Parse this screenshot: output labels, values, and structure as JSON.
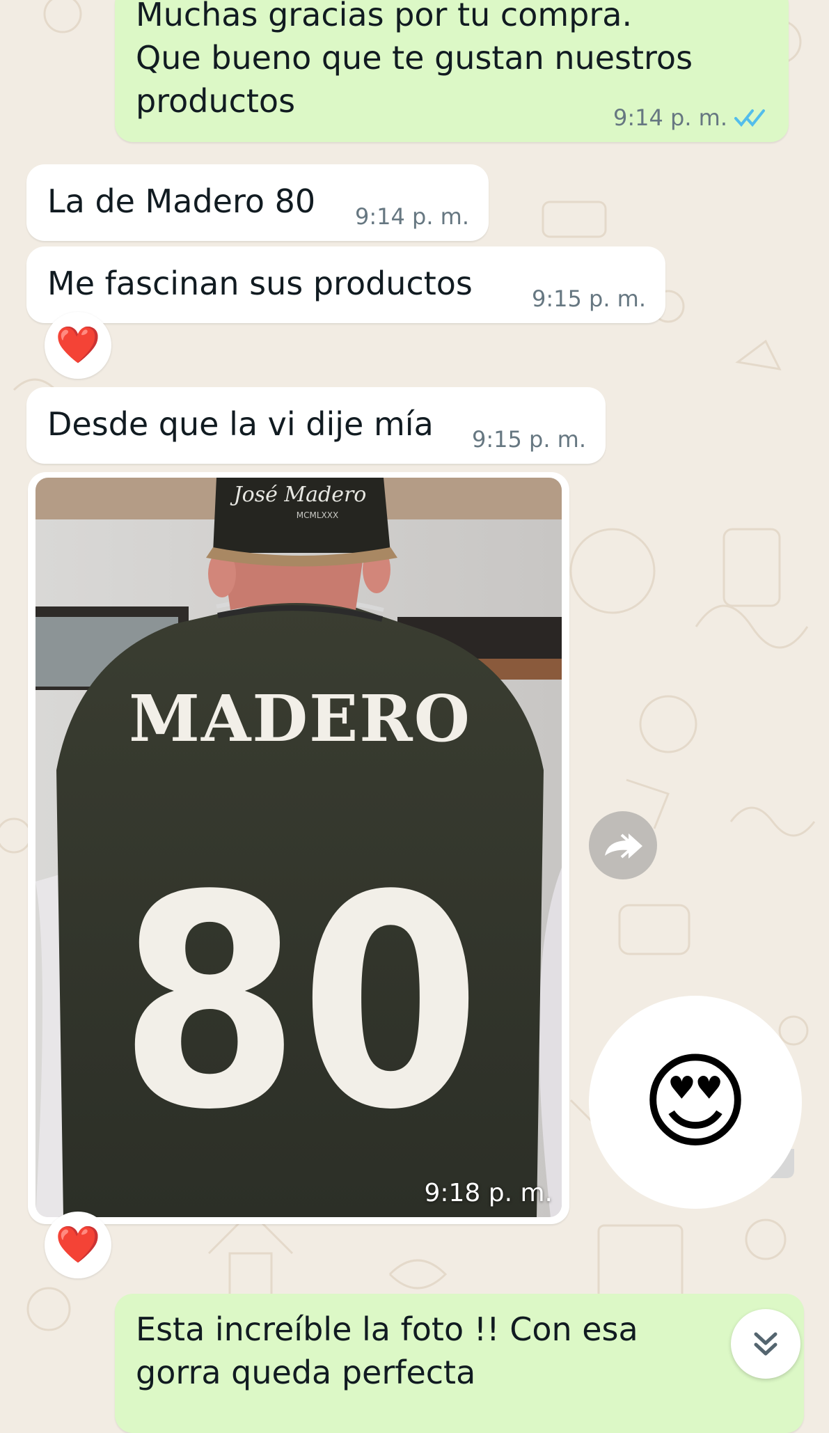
{
  "messages": [
    {
      "direction": "outgoing",
      "text": "Muchas gracias por tu compra.\nQue bueno que te gustan nuestros\nproductos",
      "time": "9:14 p. m.",
      "status": "read"
    },
    {
      "direction": "incoming",
      "text": "La de Madero 80",
      "time": "9:14 p. m."
    },
    {
      "direction": "incoming",
      "text": "Me fascinan sus productos",
      "time": "9:15 p. m.",
      "reaction": "❤️"
    },
    {
      "direction": "incoming",
      "text": "Desde que la vi dije mía",
      "time": "9:15 p. m."
    },
    {
      "direction": "incoming",
      "type": "image",
      "time": "9:18 p. m.",
      "reaction": "❤️",
      "image_content": {
        "cap_text": "José Madero",
        "cap_subtext": "MCMLXXX",
        "jacket_name": "MADERO",
        "jacket_number": "80"
      }
    },
    {
      "direction": "incoming",
      "type": "sticker",
      "sticker": "😍"
    },
    {
      "direction": "outgoing",
      "text": "Esta increíble la foto !! Con esa\ngorra queda perfecta"
    }
  ],
  "icons": {
    "read_ticks": "double-check-icon",
    "forward": "forward-icon",
    "scroll_down": "chevron-double-down-icon",
    "heart": "red-heart-emoji",
    "sticker": "heart-eyes-emoji"
  },
  "colors": {
    "outgoing_bubble": "#dcf8c6",
    "incoming_bubble": "#ffffff",
    "chat_background": "#f2ece3",
    "read_ticks": "#53bdeb",
    "timestamp": "#667781"
  }
}
